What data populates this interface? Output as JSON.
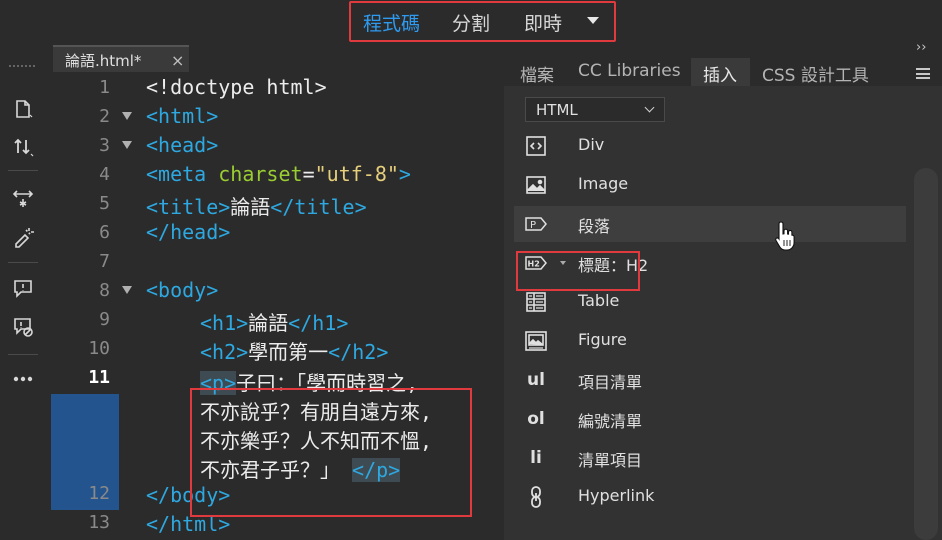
{
  "view_switcher": {
    "items": [
      {
        "label": "程式碼",
        "active": true
      },
      {
        "label": "分割",
        "active": false
      },
      {
        "label": "即時",
        "active": false
      }
    ]
  },
  "left_toolbar": {
    "tools": [
      "new-file-icon",
      "sort-icon",
      "expand-collapse-icon",
      "format-icon",
      "comment-icon",
      "remove-comment-icon",
      "more-icon"
    ]
  },
  "editor": {
    "tab": {
      "name": "論語.html*",
      "close": "×"
    },
    "current_line": 11,
    "lines": [
      {
        "n": "1"
      },
      {
        "n": "2"
      },
      {
        "n": "3"
      },
      {
        "n": "4"
      },
      {
        "n": "5"
      },
      {
        "n": "6"
      },
      {
        "n": "7"
      },
      {
        "n": "8"
      },
      {
        "n": "9"
      },
      {
        "n": "10"
      },
      {
        "n": "11"
      },
      {
        "n": "12"
      },
      {
        "n": "13"
      }
    ],
    "code": {
      "l1": "<!doctype html>",
      "l2": "<html>",
      "l3": "<head>",
      "l4_tag": "<meta",
      "l4_attr": "charset",
      "l4_eq": "=",
      "l4_val": "\"utf-8\"",
      "l4_end": ">",
      "l5_open": "<title>",
      "l5_text": "論語",
      "l5_close": "</title>",
      "l6": "</head>",
      "l8": "<body>",
      "l9_open": "<h1>",
      "l9_text": "論語",
      "l9_close": "</h1>",
      "l10_open": "<h2>",
      "l10_text": "學而第一",
      "l10_close": "</h2>",
      "p_open": "<p>",
      "p_text1": "子曰：「學而時習之,",
      "p_text2": "不亦說乎？有朋自遠方來,",
      "p_text3": "不亦樂乎？人不知而不慍,",
      "p_text4": "不亦君子乎？」",
      "p_close": "</p>",
      "l12": "</body>",
      "l13": "</html>"
    }
  },
  "panel": {
    "expand": "››",
    "tabs": [
      {
        "label": "檔案"
      },
      {
        "label": "CC Libraries"
      },
      {
        "label": "插入",
        "active": true
      },
      {
        "label": "CSS 設計工具"
      }
    ],
    "category": "HTML",
    "items": [
      {
        "label": "Div",
        "icon": "div-icon"
      },
      {
        "label": "Image",
        "icon": "image-icon"
      },
      {
        "label": "段落",
        "icon": "paragraph-icon",
        "highlighted": true
      },
      {
        "label": "標題：H2",
        "icon": "heading-icon",
        "icon_text": "H2"
      },
      {
        "label": "Table",
        "icon": "table-icon"
      },
      {
        "label": "Figure",
        "icon": "figure-icon"
      },
      {
        "label": "項目清單",
        "icon": "unordered-list-icon",
        "icon_text": "ul"
      },
      {
        "label": "編號清單",
        "icon": "ordered-list-icon",
        "icon_text": "ol"
      },
      {
        "label": "清單項目",
        "icon": "list-item-icon",
        "icon_text": "li"
      },
      {
        "label": "Hyperlink",
        "icon": "hyperlink-icon"
      }
    ]
  },
  "colors": {
    "accent": "#2e9bf0",
    "highlight_border": "#e0393e",
    "tag": "#2ea8e0",
    "attr": "#9acd32",
    "string": "#e6cf7a"
  }
}
